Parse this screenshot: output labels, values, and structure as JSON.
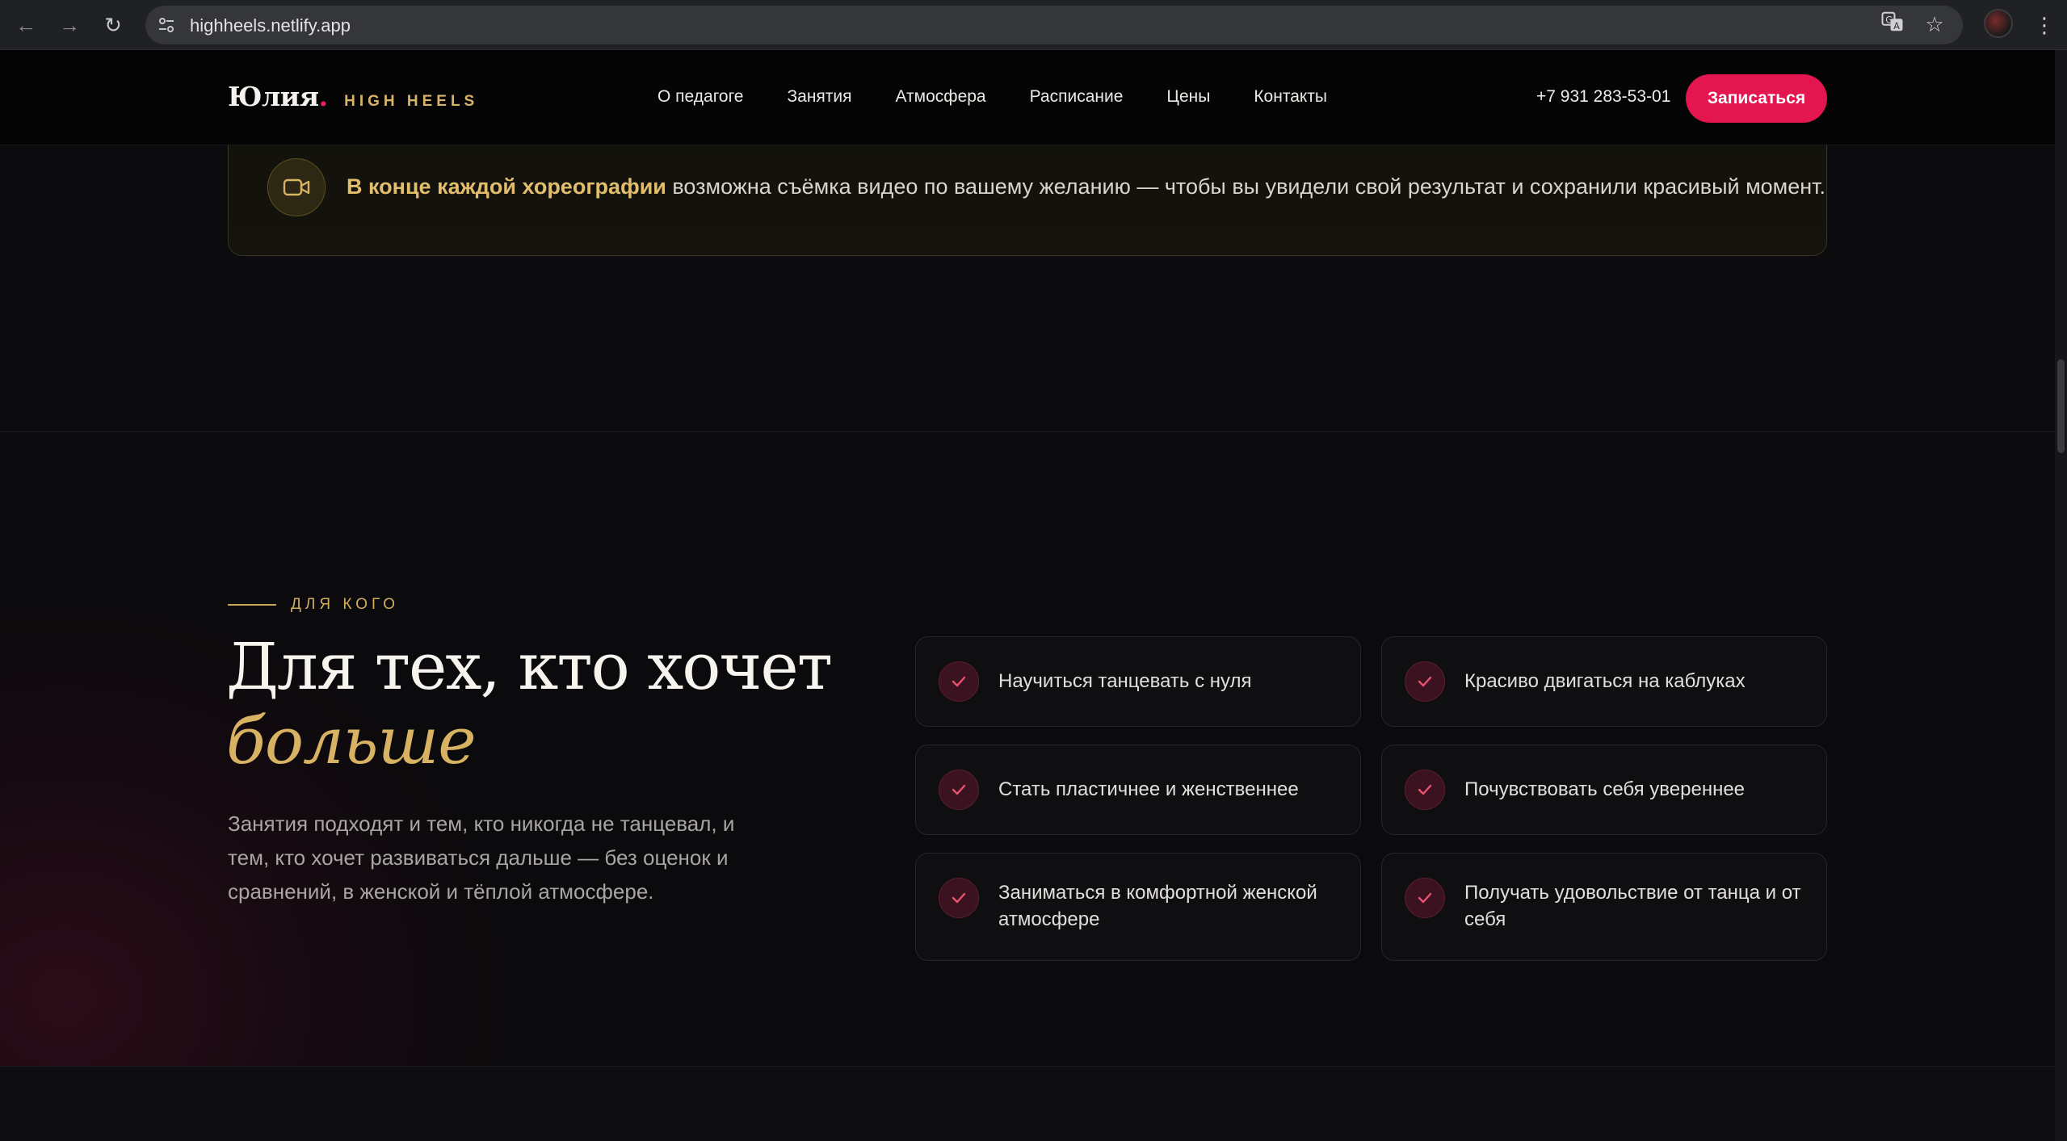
{
  "browser": {
    "url": "highheels.netlify.app",
    "icons": [
      "back-arrow-icon",
      "forward-arrow-icon",
      "reload-icon",
      "site-settings-icon",
      "translate-icon",
      "bookmark-star-icon",
      "profile-avatar",
      "kebab-menu-icon"
    ]
  },
  "header": {
    "logo_name": "Юлия",
    "logo_dot": ".",
    "logo_subtitle": "HIGH HEELS",
    "menu": [
      "О педагоге",
      "Занятия",
      "Атмосфера",
      "Расписание",
      "Цены",
      "Контакты"
    ],
    "phone": "+7 931 283-53-01",
    "cta_label": "Записаться"
  },
  "notice": {
    "icon": "video-camera-icon",
    "strong": "В конце каждой хореографии",
    "text": " возможна съёмка видео по вашему желанию — чтобы вы увидели свой результат и сохранили красивый момент."
  },
  "audience": {
    "eyebrow": "ДЛЯ КОГО",
    "title": "Для тех, кто хочет",
    "title_accent": "больше",
    "lead": "Занятия подходят и тем, кто никогда не танцевал, и тем, кто хочет развиваться дальше — без оценок и сравнений, в женской и тёплой атмосфере.",
    "items": [
      "Научиться танцевать с нуля",
      "Красиво двигаться на каблуках",
      "Стать пластичнее и женственнее",
      "Почувствовать себя увереннее",
      "Заниматься в комфортной женской атмосфере",
      "Получать удовольствие от танца и от себя"
    ]
  },
  "colors": {
    "accent_gold": "#d8b263",
    "accent_pink": "#e3164f",
    "background": "#0b0b0d"
  }
}
